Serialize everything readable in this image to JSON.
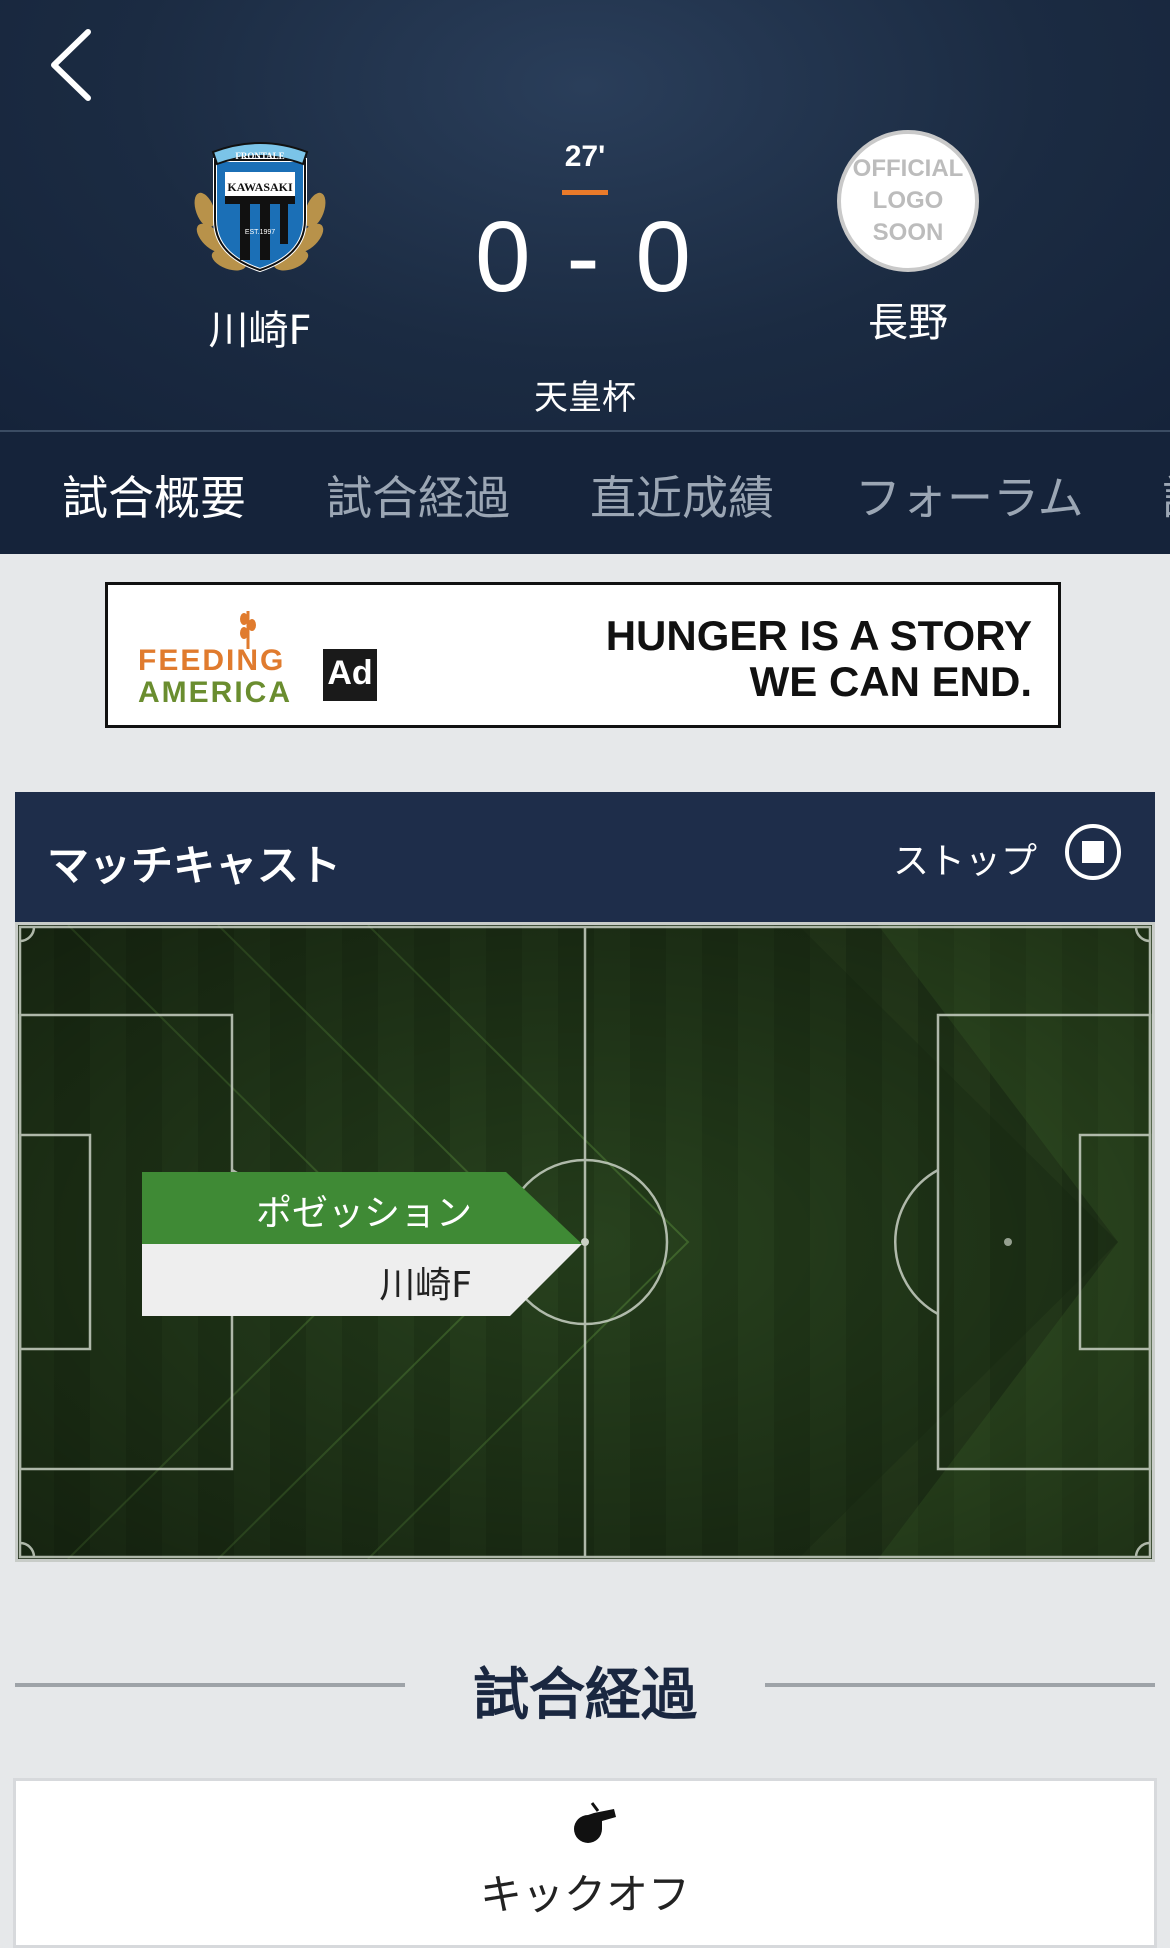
{
  "header": {
    "back_icon": "chevron-left-icon",
    "home_team": {
      "name": "川崎F",
      "crest": {
        "banner": "FRONTALE",
        "name": "KAWASAKI",
        "est": "EST.1997"
      }
    },
    "away_team": {
      "name": "長野",
      "logo_text": [
        "OFFICIAL",
        "LOGO",
        "SOON"
      ]
    },
    "minute": "27'",
    "score": "0 - 0",
    "competition": "天皇杯"
  },
  "tabs": [
    {
      "label": "試合概要",
      "active": true
    },
    {
      "label": "試合経過",
      "active": false
    },
    {
      "label": "直近成績",
      "active": false
    },
    {
      "label": "フォーラム",
      "active": false
    },
    {
      "label": "試",
      "active": false
    }
  ],
  "ad": {
    "brand_line1": "FEEDING",
    "brand_line2": "AMERICA",
    "council": "Ad",
    "headline_line1": "HUNGER IS A STORY",
    "headline_line2": "WE CAN END."
  },
  "matchcast": {
    "title": "マッチキャスト",
    "stop_label": "ストップ",
    "stop_icon": "stop-icon",
    "possession_label": "ポゼッション",
    "possession_team": "川崎F"
  },
  "section": {
    "title": "試合経過"
  },
  "events": [
    {
      "icon": "whistle-icon",
      "label": "キックオフ"
    }
  ],
  "colors": {
    "header_bg": "#1b2b42",
    "minute_accent": "#e97a2a",
    "possession_green": "#3f8a35",
    "matchcast_bar": "#1e2d4a"
  }
}
